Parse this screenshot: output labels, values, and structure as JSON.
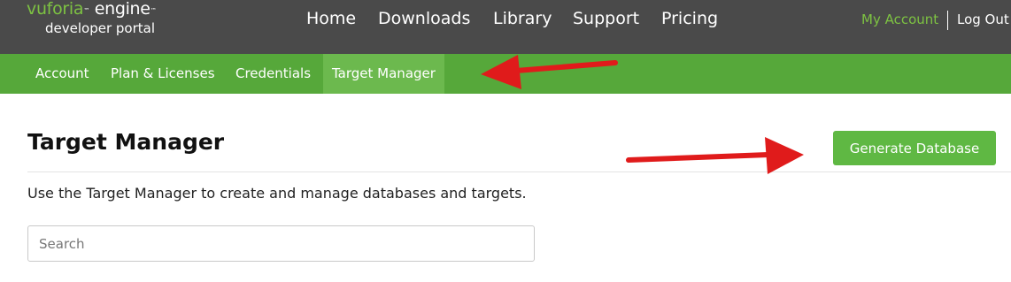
{
  "logo": {
    "brand": "vuforia",
    "product": "engine",
    "trademark": "™",
    "subtitle": "developer portal"
  },
  "main_nav": [
    "Home",
    "Downloads",
    "Library",
    "Support",
    "Pricing"
  ],
  "account": {
    "my_account": "My Account",
    "log_out": "Log Out"
  },
  "sub_nav": {
    "items": [
      "Account",
      "Plan & Licenses",
      "Credentials",
      "Target Manager"
    ],
    "active": "Target Manager"
  },
  "page": {
    "title": "Target Manager",
    "generate_button": "Generate Database",
    "description": "Use the Target Manager to create and manage databases and targets.",
    "search_placeholder": "Search",
    "search_value": ""
  },
  "colors": {
    "topbar": "#4a4a4a",
    "subnav": "#56a83a",
    "subnav_active": "#6cb94e",
    "accent": "#7dc242",
    "button": "#5fb843",
    "annotation_arrow": "#e01b1b"
  },
  "icons": [
    "annotation-arrow-icon",
    "annotation-arrow-icon"
  ]
}
